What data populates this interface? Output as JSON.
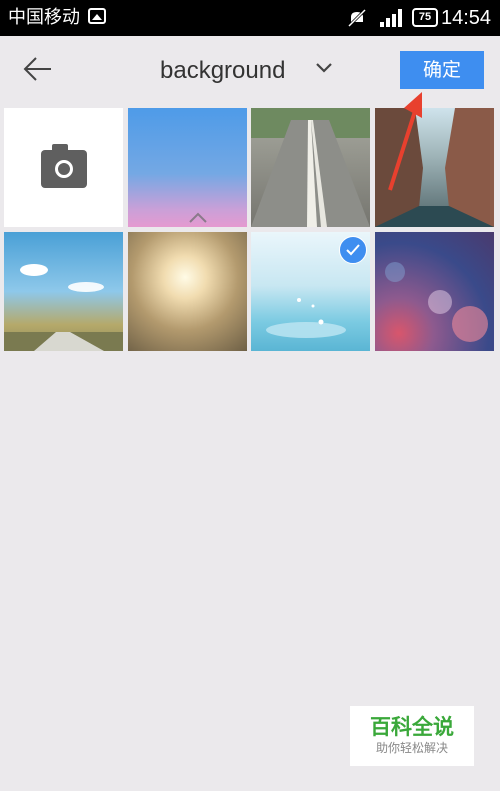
{
  "status_bar": {
    "carrier": "中国移动",
    "battery": "75",
    "time": "14:54",
    "icons": [
      "gallery-icon",
      "muted-icon",
      "signal-icon",
      "battery-icon"
    ]
  },
  "header": {
    "back_icon": "arrow-left-icon",
    "folder_name": "background",
    "dropdown_icon": "chevron-down-icon",
    "confirm_label": "确定",
    "accent_color": "#3e8ef0"
  },
  "grid": {
    "camera_tile": "camera-icon",
    "photos": [
      {
        "subject": "blue-pink sky gradient",
        "selected": false
      },
      {
        "subject": "road with center line",
        "selected": false
      },
      {
        "subject": "city street",
        "selected": false
      },
      {
        "subject": "road under blue sky",
        "selected": false
      },
      {
        "subject": "sun through trees",
        "selected": false
      },
      {
        "subject": "water splash",
        "selected": true
      },
      {
        "subject": "bokeh lights",
        "selected": false
      }
    ]
  },
  "watermark": {
    "title": "百科全说",
    "subtitle": "助你轻松解决"
  }
}
